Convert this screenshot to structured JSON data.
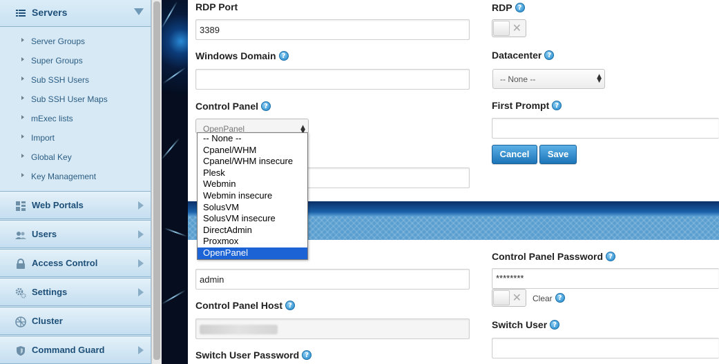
{
  "sidebar": {
    "servers": {
      "label": "Servers",
      "items": [
        "Server Groups",
        "Super Groups",
        "Sub SSH Users",
        "Sub SSH User Maps",
        "mExec lists",
        "Import",
        "Global Key",
        "Key Management"
      ]
    },
    "sections": [
      {
        "label": "Web Portals",
        "icon": "grid-icon"
      },
      {
        "label": "Users",
        "icon": "users-icon"
      },
      {
        "label": "Access Control",
        "icon": "lock-icon"
      },
      {
        "label": "Settings",
        "icon": "gears-icon"
      },
      {
        "label": "Cluster",
        "icon": "cluster-icon"
      },
      {
        "label": "Command Guard",
        "icon": "shield-icon"
      }
    ]
  },
  "form": {
    "rdp_port": {
      "label": "RDP Port",
      "value": "3389"
    },
    "rdp": {
      "label": "RDP",
      "enabled": false
    },
    "windows_domain": {
      "label": "Windows Domain",
      "value": ""
    },
    "datacenter": {
      "label": "Datacenter",
      "value": "-- None --"
    },
    "control_panel": {
      "label": "Control Panel",
      "value": "OpenPanel",
      "options": [
        "-- None --",
        "Cpanel/WHM",
        "Cpanel/WHM insecure",
        "Plesk",
        "Webmin",
        "Webmin insecure",
        "SolusVM",
        "SolusVM insecure",
        "DirectAdmin",
        "Proxmox",
        "OpenPanel"
      ],
      "selected_index": 10
    },
    "first_prompt": {
      "label": "First Prompt",
      "value": ""
    },
    "cancel_label": "Cancel",
    "save_label": "Save",
    "cp_user": {
      "value": "admin"
    },
    "cp_password": {
      "label": "Control Panel Password",
      "value": "********",
      "clear_label": "Clear"
    },
    "cp_host": {
      "label": "Control Panel Host"
    },
    "switch_user": {
      "label": "Switch User",
      "value": ""
    },
    "switch_user_password": {
      "label": "Switch User Password"
    }
  },
  "colors": {
    "accent": "#1c74b8",
    "sidebar_bg": "#d6e9f4",
    "selected_option": "#1c63d6"
  }
}
